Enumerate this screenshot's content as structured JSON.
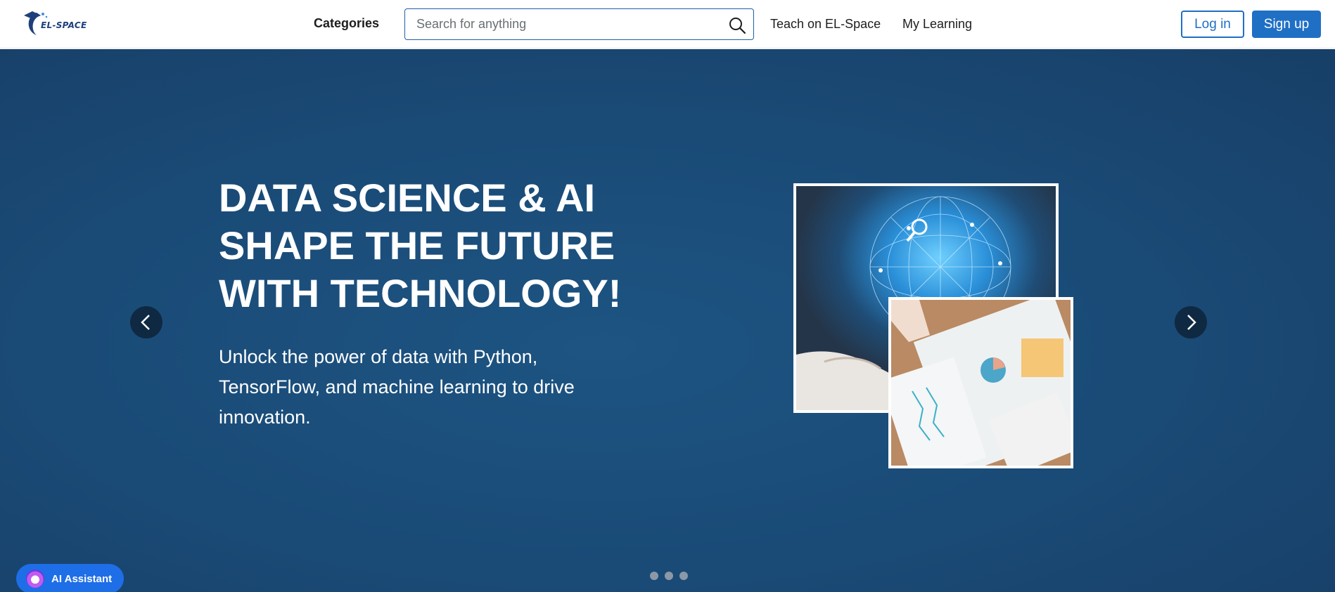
{
  "header": {
    "logo_text": "EL-SPACE",
    "categories_label": "Categories",
    "search_placeholder": "Search for anything",
    "teach_label": "Teach on EL-Space",
    "learning_label": "My Learning",
    "login_label": "Log in",
    "signup_label": "Sign up"
  },
  "hero": {
    "title_lines": [
      "DATA SCIENCE & AI",
      "SHAPE THE FUTURE",
      "WITH TECHNOLOGY!"
    ],
    "subtitle": "Unlock the power of data with Python, TensorFlow, and machine learning to drive innovation.",
    "slide_count": 3,
    "active_slide": 1
  },
  "assistant": {
    "label": "AI Assistant"
  },
  "colors": {
    "brand_blue": "#1f6fc5",
    "hero_bg": "#1a4a76",
    "assistant_bg": "#1e6ee8"
  },
  "icons": {
    "search": "search-icon",
    "prev": "chevron-left-icon",
    "next": "chevron-right-icon"
  }
}
